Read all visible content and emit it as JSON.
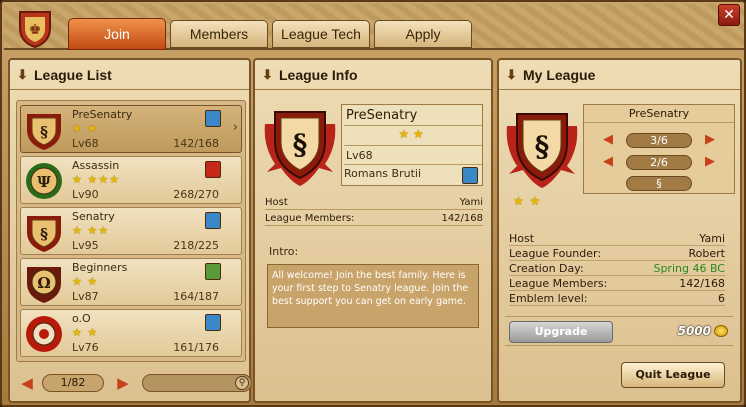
{
  "tabs": [
    {
      "label": "Join",
      "active": true
    },
    {
      "label": "Members",
      "active": false
    },
    {
      "label": "League Tech",
      "active": false
    },
    {
      "label": "Apply",
      "active": false
    }
  ],
  "close_icon": "close-icon",
  "league_list": {
    "title": "League List",
    "items": [
      {
        "name": "PreSenatry",
        "stars": "★ ★",
        "level": "Lv68",
        "members": "142/168",
        "symbol": "§",
        "race_color": "blue",
        "selected": true
      },
      {
        "name": "Assassin",
        "stars": "★ ★★★",
        "level": "Lv90",
        "members": "268/270",
        "symbol": "Ψ",
        "race_color": "red",
        "selected": false
      },
      {
        "name": "Senatry",
        "stars": "★ ★★",
        "level": "Lv95",
        "members": "218/225",
        "symbol": "§",
        "race_color": "blue",
        "selected": false
      },
      {
        "name": "Beginners",
        "stars": "★ ★",
        "level": "Lv87",
        "members": "164/187",
        "symbol": "Ω",
        "race_color": "green",
        "selected": false
      },
      {
        "name": "o.O",
        "stars": "★ ★",
        "level": "Lv76",
        "members": "161/176",
        "symbol": "◉",
        "race_color": "blue",
        "selected": false
      }
    ],
    "page": "1/82"
  },
  "league_info": {
    "title": "League Info",
    "name": "PreSenatry",
    "stars": "★ ★",
    "level": "Lv68",
    "realm": "Romans Brutii",
    "symbol": "§",
    "host_label": "Host",
    "host_value": "Yami",
    "members_label": "League Members:",
    "members_value": "142/168",
    "intro_label": "Intro:",
    "intro_text": "All welcome! Join the best family. Here is your first step to Senatry league. Join the best support you can get on early game."
  },
  "my_league": {
    "title": "My League",
    "name": "PreSenatry",
    "stars": "★ ★",
    "symbol": "§",
    "selector_1": "3/6",
    "selector_2": "2/6",
    "selector_3": "§",
    "host_label": "Host",
    "host_value": "Yami",
    "founder_label": "League Founder:",
    "founder_value": "Robert",
    "creation_label": "Creation Day:",
    "creation_value": "Spring 46 BC",
    "members_label": "League Members:",
    "members_value": "142/168",
    "emblem_label": "Emblem level:",
    "emblem_value": "6",
    "upgrade_label": "Upgrade",
    "upgrade_cost": "5000",
    "quit_label": "Quit League"
  },
  "colors": {
    "accent": "#c24a14",
    "race_blue": "#3a88c8",
    "race_red": "#c8281a",
    "race_green": "#5a9a38",
    "creation_day": "#2a8a1a"
  }
}
